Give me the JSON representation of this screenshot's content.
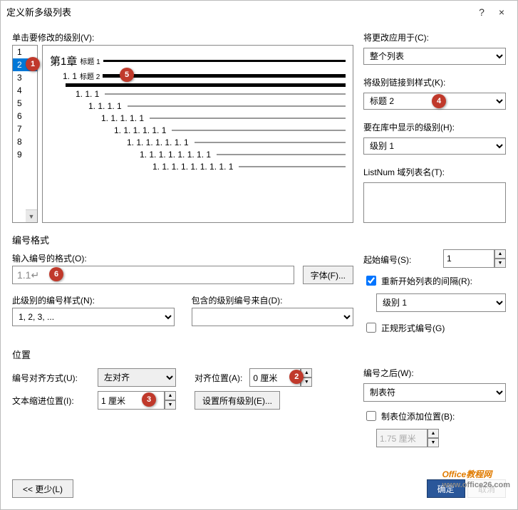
{
  "titlebar": {
    "title": "定义新多级列表",
    "help": "?",
    "close": "×"
  },
  "left": {
    "modify_level_label": "单击要修改的级别(V):",
    "levels": [
      "1",
      "2",
      "3",
      "4",
      "5",
      "6",
      "7",
      "8",
      "9"
    ],
    "selected_index": 1
  },
  "preview": {
    "lines": [
      {
        "indent": 0,
        "num": "第1章",
        "suffix": "标题 1",
        "style": "black"
      },
      {
        "indent": 1,
        "num": "1. 1",
        "suffix": "标题 2",
        "style": "bold"
      },
      {
        "indent": 2,
        "num": "",
        "suffix": "",
        "style": "bold"
      },
      {
        "indent": 3,
        "num": "1. 1. 1",
        "suffix": "",
        "style": "normal"
      },
      {
        "indent": 4,
        "num": "1. 1. 1. 1",
        "suffix": "",
        "style": "normal"
      },
      {
        "indent": 5,
        "num": "1. 1. 1. 1. 1",
        "suffix": "",
        "style": "normal"
      },
      {
        "indent": 6,
        "num": "1. 1. 1. 1. 1. 1",
        "suffix": "",
        "style": "normal"
      },
      {
        "indent": 7,
        "num": "1. 1. 1. 1. 1. 1. 1",
        "suffix": "",
        "style": "normal"
      },
      {
        "indent": 8,
        "num": "1. 1. 1. 1. 1. 1. 1. 1",
        "suffix": "",
        "style": "normal"
      },
      {
        "indent": 9,
        "num": "1. 1. 1. 1. 1. 1. 1. 1. 1",
        "suffix": "",
        "style": "normal"
      }
    ]
  },
  "right": {
    "apply_to_label": "将更改应用于(C):",
    "apply_to_value": "整个列表",
    "link_style_label": "将级别链接到样式(K):",
    "link_style_value": "标题 2",
    "gallery_level_label": "要在库中显示的级别(H):",
    "gallery_level_value": "级别 1",
    "listnum_label": "ListNum 域列表名(T):",
    "listnum_value": ""
  },
  "format": {
    "section_label": "编号格式",
    "input_format_label": "输入编号的格式(O):",
    "input_format_value": "1.1↵",
    "font_btn": "字体(F)...",
    "number_style_label": "此级别的编号样式(N):",
    "number_style_value": "1, 2, 3, ...",
    "include_from_label": "包含的级别编号来自(D):",
    "include_from_value": ""
  },
  "right_format": {
    "start_at_label": "起始编号(S):",
    "start_at_value": "1",
    "restart_after_label": "重新开始列表的间隔(R):",
    "restart_after_checked": true,
    "restart_level_value": "级别 1",
    "legal_style_label": "正规形式编号(G)",
    "legal_style_checked": false
  },
  "position": {
    "section_label": "位置",
    "align_label": "编号对齐方式(U):",
    "align_value": "左对齐",
    "aligned_at_label": "对齐位置(A):",
    "aligned_at_value": "0 厘米",
    "indent_label": "文本缩进位置(I):",
    "indent_value": "1 厘米",
    "set_all_btn": "设置所有级别(E)..."
  },
  "right_position": {
    "follow_label": "编号之后(W):",
    "follow_value": "制表符",
    "tabstop_label": "制表位添加位置(B):",
    "tabstop_checked": false,
    "tabstop_value": "1.75 厘米"
  },
  "footer": {
    "less_btn": "<< 更少(L)",
    "ok_btn": "确定",
    "cancel_btn": "取消"
  },
  "callouts": {
    "c1": "1",
    "c2": "2",
    "c3": "3",
    "c4": "4",
    "c5": "5",
    "c6": "6"
  },
  "watermark": {
    "text": "Office教程网",
    "url": "www.office26.com"
  }
}
